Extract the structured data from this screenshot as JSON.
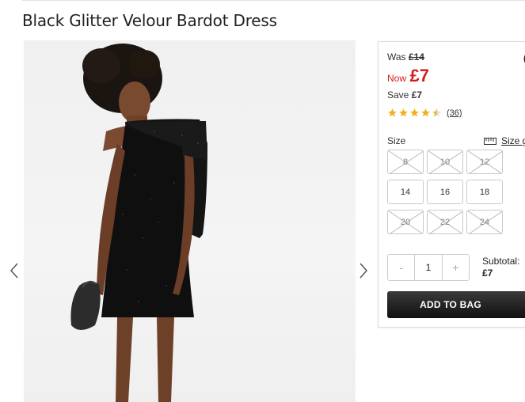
{
  "product": {
    "title": "Black Glitter Velour Bardot Dress"
  },
  "pricing": {
    "was_label": "Was",
    "was_price": "£14",
    "now_label": "Now",
    "now_price": "£7",
    "save_label": "Save",
    "save_amount": "£7"
  },
  "reviews": {
    "rating": 4.5,
    "count": "(36)"
  },
  "sizes": {
    "label": "Size",
    "guide_label": "Size gu",
    "options": [
      {
        "label": "8",
        "available": false
      },
      {
        "label": "10",
        "available": false
      },
      {
        "label": "12",
        "available": false
      },
      {
        "label": "14",
        "available": true
      },
      {
        "label": "16",
        "available": true
      },
      {
        "label": "18",
        "available": true
      },
      {
        "label": "20",
        "available": false
      },
      {
        "label": "22",
        "available": false
      },
      {
        "label": "24",
        "available": false
      }
    ]
  },
  "quantity": {
    "minus": "-",
    "value": "1",
    "plus": "+"
  },
  "subtotal": {
    "label": "Subtotal:",
    "amount": "£7"
  },
  "actions": {
    "add_to_bag": "ADD TO BAG"
  },
  "icons": {
    "prev": "chevron-left-icon",
    "next": "chevron-right-icon",
    "ruler": "ruler-icon",
    "star": "star-icon"
  },
  "colors": {
    "sale_red": "#d21e1e",
    "star_gold": "#f2b01e",
    "button_dark": "#1a1a1a"
  }
}
